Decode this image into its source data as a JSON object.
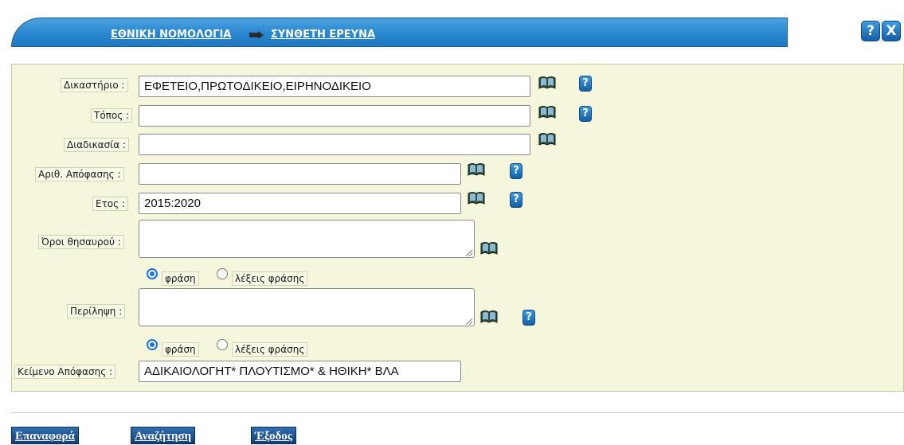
{
  "header": {
    "crumb_home": "ΕΘΝΙΚΗ ΝΟΜΟΛΟΓΙΑ",
    "crumb_current": "ΣΥΝΘΕΤΗ ΕΡΕΥΝΑ",
    "help_icon": "?",
    "close_icon": "X"
  },
  "form": {
    "court": {
      "label": "Δικαστήριο :",
      "value": "ΕΦΕΤΕΙΟ,ΠΡΩΤΟΔΙΚΕΙΟ,ΕΙΡΗΝΟΔΙΚΕΙΟ"
    },
    "place": {
      "label": "Τόπος :",
      "value": ""
    },
    "procedure": {
      "label": "Διαδικασία :",
      "value": ""
    },
    "decision_no": {
      "label": "Αριθ. Απόφασης :",
      "value": ""
    },
    "year": {
      "label": "Ετος :",
      "value": "2015:2020"
    },
    "thesaurus": {
      "label": "Όροι θησαυρού :",
      "value": ""
    },
    "radio1": {
      "phrase": "φράση",
      "words": "λέξεις φράσης",
      "selected": "phrase"
    },
    "summary": {
      "label": "Περίληψη :",
      "value": ""
    },
    "radio2": {
      "phrase": "φράση",
      "words": "λέξεις φράσης",
      "selected": "phrase"
    },
    "decision_text": {
      "label": "Κείμενο Απόφασης :",
      "value": "ΑΔΙΚΑΙΟΛΟΓΗΤ* ΠΛΟΥΤΙΣΜΟ* & ΗΘΙΚΗ* ΒΛΑ"
    },
    "help_glyph": "?"
  },
  "buttons": {
    "reset": "Επαναφορά",
    "search": "Αναζήτηση",
    "exit": "Έξοδος"
  },
  "colors": {
    "accent_blue": "#2a86cf",
    "panel_bg": "#f5f6dc",
    "button_bg": "#1f4f8c"
  }
}
